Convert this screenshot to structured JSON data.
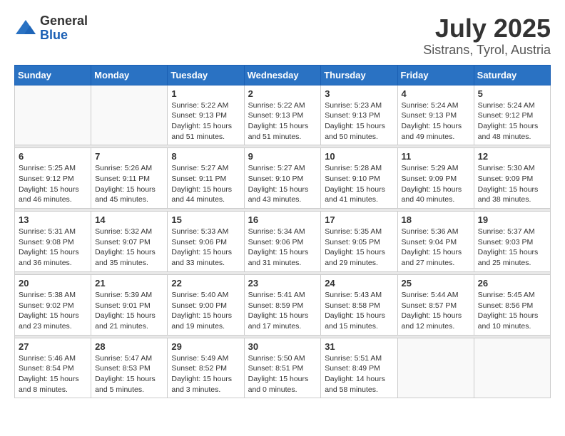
{
  "header": {
    "logo": {
      "general": "General",
      "blue": "Blue"
    },
    "title": "July 2025",
    "location": "Sistrans, Tyrol, Austria"
  },
  "calendar": {
    "days_of_week": [
      "Sunday",
      "Monday",
      "Tuesday",
      "Wednesday",
      "Thursday",
      "Friday",
      "Saturday"
    ],
    "weeks": [
      [
        {
          "day": "",
          "info": ""
        },
        {
          "day": "",
          "info": ""
        },
        {
          "day": "1",
          "info": "Sunrise: 5:22 AM\nSunset: 9:13 PM\nDaylight: 15 hours\nand 51 minutes."
        },
        {
          "day": "2",
          "info": "Sunrise: 5:22 AM\nSunset: 9:13 PM\nDaylight: 15 hours\nand 51 minutes."
        },
        {
          "day": "3",
          "info": "Sunrise: 5:23 AM\nSunset: 9:13 PM\nDaylight: 15 hours\nand 50 minutes."
        },
        {
          "day": "4",
          "info": "Sunrise: 5:24 AM\nSunset: 9:13 PM\nDaylight: 15 hours\nand 49 minutes."
        },
        {
          "day": "5",
          "info": "Sunrise: 5:24 AM\nSunset: 9:12 PM\nDaylight: 15 hours\nand 48 minutes."
        }
      ],
      [
        {
          "day": "6",
          "info": "Sunrise: 5:25 AM\nSunset: 9:12 PM\nDaylight: 15 hours\nand 46 minutes."
        },
        {
          "day": "7",
          "info": "Sunrise: 5:26 AM\nSunset: 9:11 PM\nDaylight: 15 hours\nand 45 minutes."
        },
        {
          "day": "8",
          "info": "Sunrise: 5:27 AM\nSunset: 9:11 PM\nDaylight: 15 hours\nand 44 minutes."
        },
        {
          "day": "9",
          "info": "Sunrise: 5:27 AM\nSunset: 9:10 PM\nDaylight: 15 hours\nand 43 minutes."
        },
        {
          "day": "10",
          "info": "Sunrise: 5:28 AM\nSunset: 9:10 PM\nDaylight: 15 hours\nand 41 minutes."
        },
        {
          "day": "11",
          "info": "Sunrise: 5:29 AM\nSunset: 9:09 PM\nDaylight: 15 hours\nand 40 minutes."
        },
        {
          "day": "12",
          "info": "Sunrise: 5:30 AM\nSunset: 9:09 PM\nDaylight: 15 hours\nand 38 minutes."
        }
      ],
      [
        {
          "day": "13",
          "info": "Sunrise: 5:31 AM\nSunset: 9:08 PM\nDaylight: 15 hours\nand 36 minutes."
        },
        {
          "day": "14",
          "info": "Sunrise: 5:32 AM\nSunset: 9:07 PM\nDaylight: 15 hours\nand 35 minutes."
        },
        {
          "day": "15",
          "info": "Sunrise: 5:33 AM\nSunset: 9:06 PM\nDaylight: 15 hours\nand 33 minutes."
        },
        {
          "day": "16",
          "info": "Sunrise: 5:34 AM\nSunset: 9:06 PM\nDaylight: 15 hours\nand 31 minutes."
        },
        {
          "day": "17",
          "info": "Sunrise: 5:35 AM\nSunset: 9:05 PM\nDaylight: 15 hours\nand 29 minutes."
        },
        {
          "day": "18",
          "info": "Sunrise: 5:36 AM\nSunset: 9:04 PM\nDaylight: 15 hours\nand 27 minutes."
        },
        {
          "day": "19",
          "info": "Sunrise: 5:37 AM\nSunset: 9:03 PM\nDaylight: 15 hours\nand 25 minutes."
        }
      ],
      [
        {
          "day": "20",
          "info": "Sunrise: 5:38 AM\nSunset: 9:02 PM\nDaylight: 15 hours\nand 23 minutes."
        },
        {
          "day": "21",
          "info": "Sunrise: 5:39 AM\nSunset: 9:01 PM\nDaylight: 15 hours\nand 21 minutes."
        },
        {
          "day": "22",
          "info": "Sunrise: 5:40 AM\nSunset: 9:00 PM\nDaylight: 15 hours\nand 19 minutes."
        },
        {
          "day": "23",
          "info": "Sunrise: 5:41 AM\nSunset: 8:59 PM\nDaylight: 15 hours\nand 17 minutes."
        },
        {
          "day": "24",
          "info": "Sunrise: 5:43 AM\nSunset: 8:58 PM\nDaylight: 15 hours\nand 15 minutes."
        },
        {
          "day": "25",
          "info": "Sunrise: 5:44 AM\nSunset: 8:57 PM\nDaylight: 15 hours\nand 12 minutes."
        },
        {
          "day": "26",
          "info": "Sunrise: 5:45 AM\nSunset: 8:56 PM\nDaylight: 15 hours\nand 10 minutes."
        }
      ],
      [
        {
          "day": "27",
          "info": "Sunrise: 5:46 AM\nSunset: 8:54 PM\nDaylight: 15 hours\nand 8 minutes."
        },
        {
          "day": "28",
          "info": "Sunrise: 5:47 AM\nSunset: 8:53 PM\nDaylight: 15 hours\nand 5 minutes."
        },
        {
          "day": "29",
          "info": "Sunrise: 5:49 AM\nSunset: 8:52 PM\nDaylight: 15 hours\nand 3 minutes."
        },
        {
          "day": "30",
          "info": "Sunrise: 5:50 AM\nSunset: 8:51 PM\nDaylight: 15 hours\nand 0 minutes."
        },
        {
          "day": "31",
          "info": "Sunrise: 5:51 AM\nSunset: 8:49 PM\nDaylight: 14 hours\nand 58 minutes."
        },
        {
          "day": "",
          "info": ""
        },
        {
          "day": "",
          "info": ""
        }
      ]
    ]
  }
}
